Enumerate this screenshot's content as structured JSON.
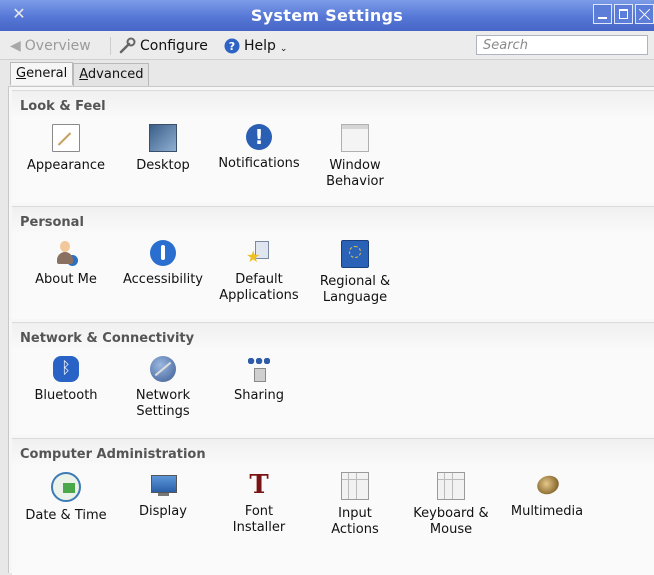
{
  "window": {
    "title": "System Settings"
  },
  "toolbar": {
    "overview_label": "Overview",
    "configure_label": "Configure",
    "help_label": "Help",
    "search_placeholder": "Search"
  },
  "tabs": [
    {
      "label": "General",
      "underline": "G",
      "active": true
    },
    {
      "label": "Advanced",
      "underline": "A",
      "active": false
    }
  ],
  "sections": [
    {
      "title": "Look & Feel",
      "items": [
        {
          "label": "Appearance",
          "icon": "appearance-icon"
        },
        {
          "label": "Desktop",
          "icon": "desktop-icon"
        },
        {
          "label": "Notifications",
          "icon": "notifications-icon"
        },
        {
          "label": "Window\nBehavior",
          "icon": "window-behavior-icon"
        }
      ]
    },
    {
      "title": "Personal",
      "items": [
        {
          "label": "About Me",
          "icon": "about-me-icon"
        },
        {
          "label": "Accessibility",
          "icon": "accessibility-icon"
        },
        {
          "label": "Default\nApplications",
          "icon": "default-applications-icon"
        },
        {
          "label": "Regional &\nLanguage",
          "icon": "regional-language-icon"
        }
      ]
    },
    {
      "title": "Network & Connectivity",
      "items": [
        {
          "label": "Bluetooth",
          "icon": "bluetooth-icon"
        },
        {
          "label": "Network\nSettings",
          "icon": "network-settings-icon"
        },
        {
          "label": "Sharing",
          "icon": "sharing-icon"
        }
      ]
    },
    {
      "title": "Computer Administration",
      "items": [
        {
          "label": "Date & Time",
          "icon": "date-time-icon"
        },
        {
          "label": "Display",
          "icon": "display-icon"
        },
        {
          "label": "Font\nInstaller",
          "icon": "font-installer-icon"
        },
        {
          "label": "Input\nActions",
          "icon": "input-actions-icon"
        },
        {
          "label": "Keyboard &\nMouse",
          "icon": "keyboard-mouse-icon"
        },
        {
          "label": "Multimedia",
          "icon": "multimedia-icon"
        }
      ]
    }
  ]
}
